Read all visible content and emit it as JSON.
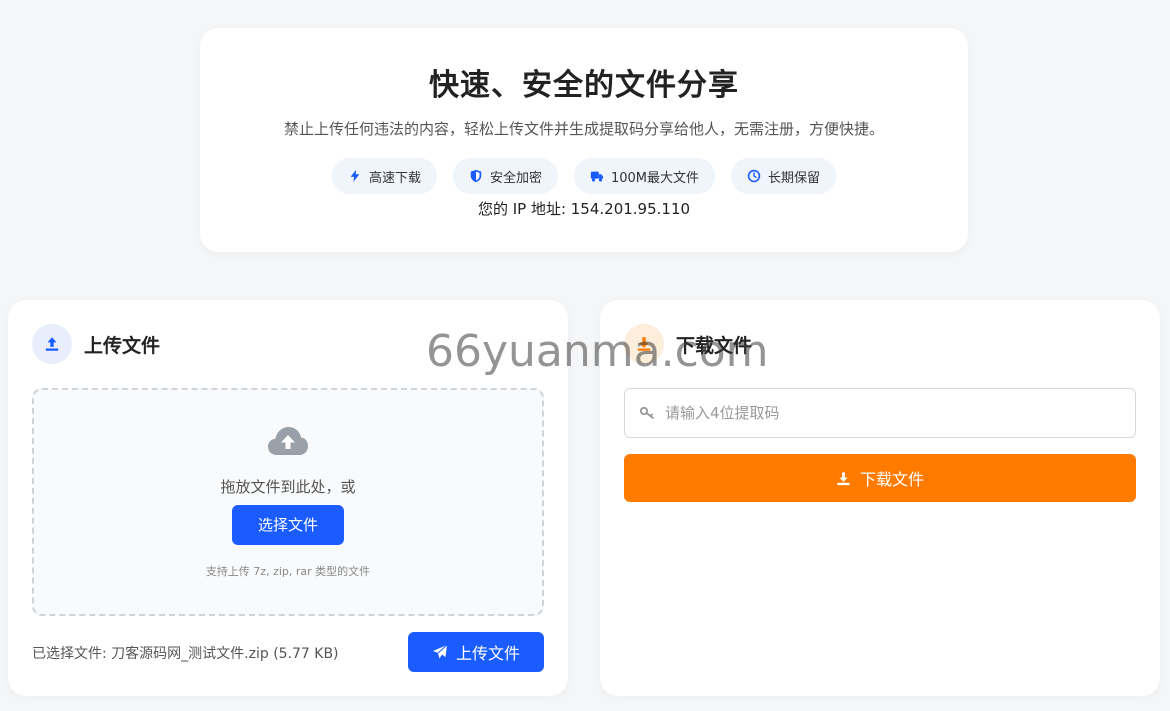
{
  "hero": {
    "title": "快速、安全的文件分享",
    "subtitle": "禁止上传任何违法的内容，轻松上传文件并生成提取码分享给他人，无需注册，方便快捷。",
    "features": [
      {
        "icon": "bolt-icon",
        "label": "高速下载"
      },
      {
        "icon": "shield-icon",
        "label": "安全加密"
      },
      {
        "icon": "truck-icon",
        "label": "100M最大文件"
      },
      {
        "icon": "clock-icon",
        "label": "长期保留"
      }
    ],
    "ip_text": "您的 IP 地址: 154.201.95.110"
  },
  "upload": {
    "title": "上传文件",
    "drop_text": "拖放文件到此处，或",
    "choose_label": "选择文件",
    "hint": "支持上传 7z, zip, rar 类型的文件",
    "selected_text": "已选择文件: 刀客源码网_测试文件.zip (5.77 KB)",
    "upload_label": "上传文件"
  },
  "download": {
    "title": "下载文件",
    "code_placeholder": "请输入4位提取码",
    "download_label": "下载文件"
  },
  "watermark": "66yuanma.com",
  "colors": {
    "primary": "#1a5cff",
    "accent": "#ff7b00",
    "background": "#f5f6f8"
  }
}
